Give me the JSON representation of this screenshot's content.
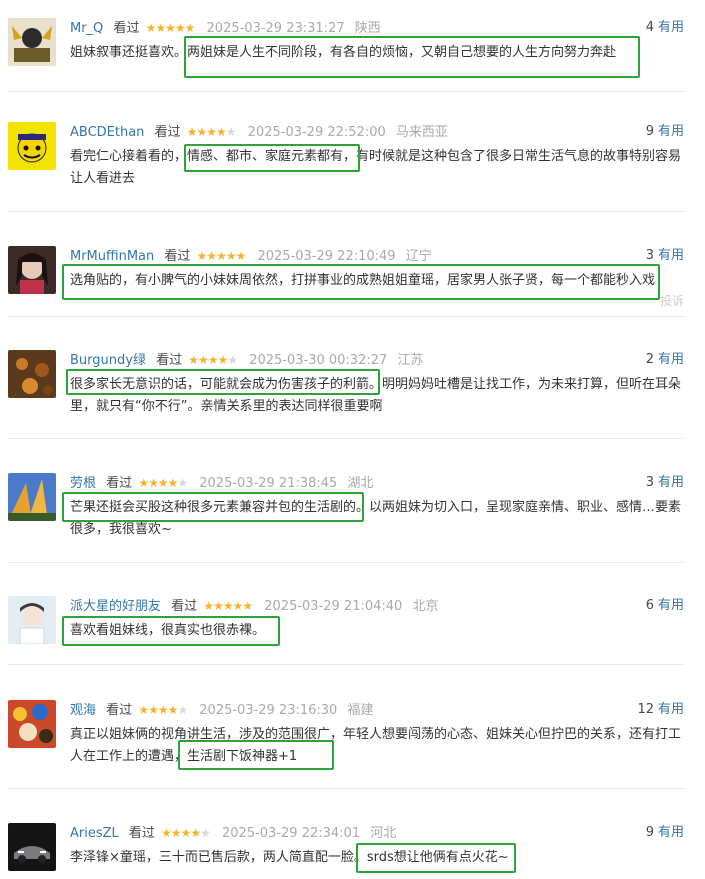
{
  "reviews": [
    {
      "user": "Mr_Q",
      "status": "看过",
      "stars": 5,
      "time": "2025-03-29 23:31:27",
      "location": "陕西",
      "votes": "4",
      "useful": "有用",
      "line1": "姐妹叙事还挺喜欢。两姐妹是人生不同阶段，有各自的烦恼，又朝自己想要的人生方向努力奔赴",
      "line2": ""
    },
    {
      "user": "ABCDEthan",
      "status": "看过",
      "stars": 4,
      "time": "2025-03-29 22:52:00",
      "location": "马来西亚",
      "votes": "9",
      "useful": "有用",
      "line1": "看完仁心接着看的，情感、都市、家庭元素都有，有时候就是这种包含了很多日常生活气息的故事特别容易",
      "line2": "让人看进去"
    },
    {
      "user": "MrMuffinMan",
      "status": "看过",
      "stars": 5,
      "time": "2025-03-29 22:10:49",
      "location": "辽宁",
      "votes": "3",
      "useful": "有用",
      "line1": "选角贴的，有小脾气的小妹妹周依然，打拼事业的成熟姐姐童瑶，居家男人张子贤，每一个都能秒入戏",
      "line2": "",
      "report": "投诉"
    },
    {
      "user": "Burgundy绿",
      "status": "看过",
      "stars": 4,
      "time": "2025-03-30 00:32:27",
      "location": "江苏",
      "votes": "2",
      "useful": "有用",
      "line1": "很多家长无意识的话，可能就会成为伤害孩子的利箭。明明妈妈吐槽是让找工作，为未来打算，但听在耳朵",
      "line2": "里，就只有“你不行”。亲情关系里的表达同样很重要啊"
    },
    {
      "user": "劳根",
      "status": "看过",
      "stars": 4,
      "time": "2025-03-29 21:38:45",
      "location": "湖北",
      "votes": "3",
      "useful": "有用",
      "line1": "芒果还挺会买股这种很多元素兼容并包的生活剧的。以两姐妹为切入口，呈现家庭亲情、职业、感情…要素",
      "line2": "很多，我很喜欢~"
    },
    {
      "user": "派大星的好朋友",
      "status": "看过",
      "stars": 5,
      "time": "2025-03-29 21:04:40",
      "location": "北京",
      "votes": "6",
      "useful": "有用",
      "line1": "喜欢看姐妹线，很真实也很赤裸。",
      "line2": ""
    },
    {
      "user": "观海",
      "status": "看过",
      "stars": 4,
      "time": "2025-03-29 23:16:30",
      "location": "福建",
      "votes": "12",
      "useful": "有用",
      "line1": "真正以姐妹俩的视角讲生活，涉及的范围很广，年轻人想要闯荡的心态、姐妹关心但拧巴的关系，还有打工",
      "line2": "人在工作上的遭遇，生活剧下饭神器+1"
    },
    {
      "user": "AriesZL",
      "status": "看过",
      "stars": 4,
      "time": "2025-03-29 22:34:01",
      "location": "河北",
      "votes": "9",
      "useful": "有用",
      "line1": "李泽锋×童瑶，三十而已售后款，两人简直配一脸。srds想让他俩有点火花~",
      "line2": ""
    }
  ],
  "colors": {
    "highlight": "#2ca43a",
    "link": "#3377aa",
    "star": "#f5b42a"
  },
  "icons": [
    "star-icon"
  ]
}
